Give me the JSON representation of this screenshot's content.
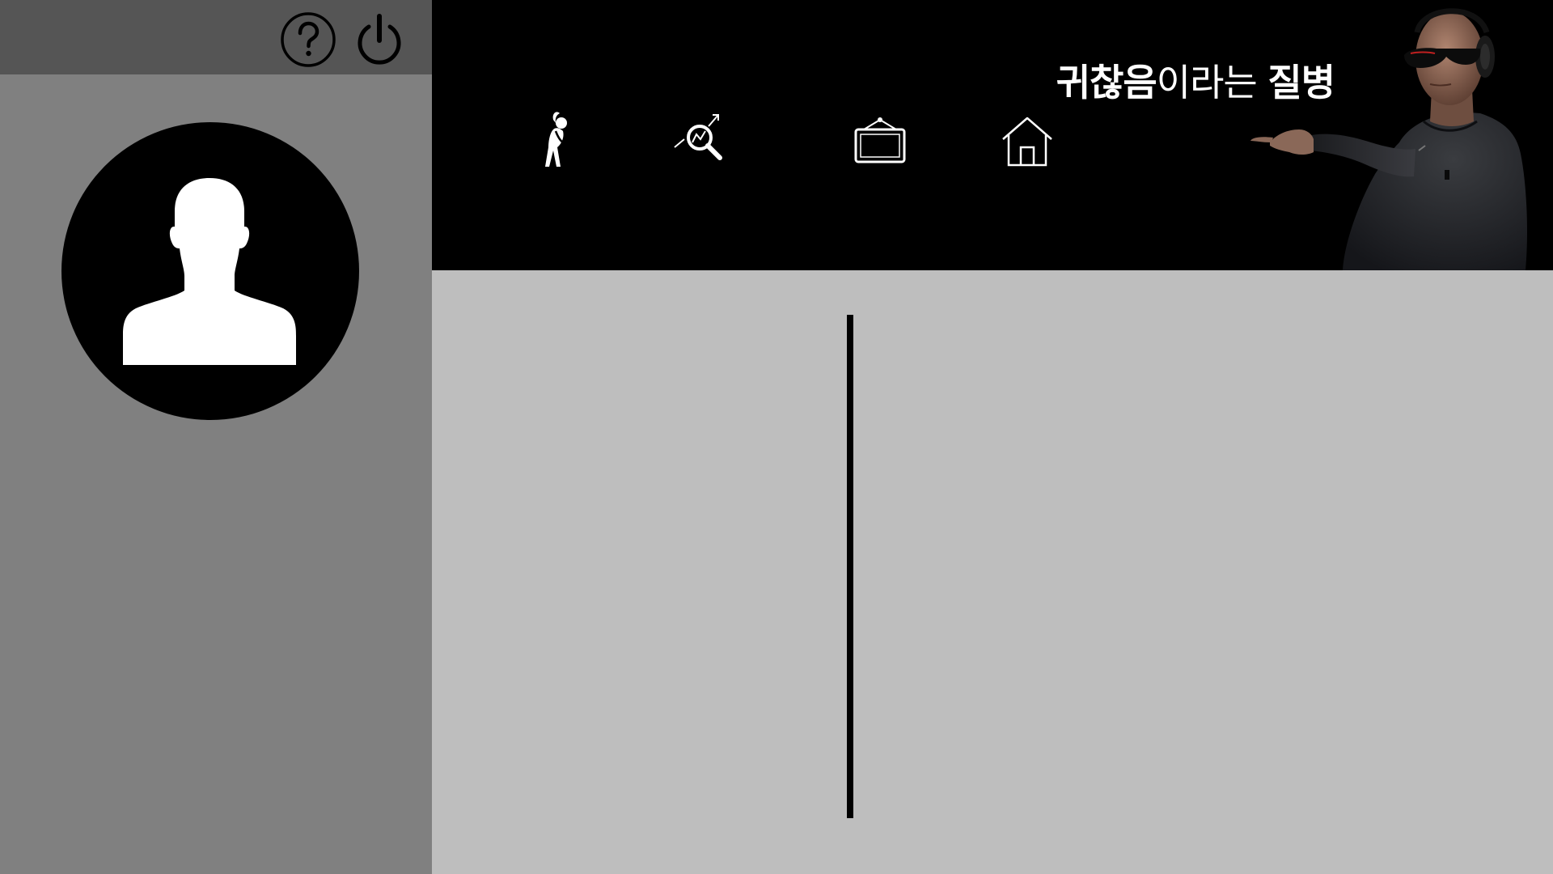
{
  "banner": {
    "word1": "귀찮음",
    "word2": "이라는",
    "word3": "질병"
  },
  "icons": {
    "help": "help-circle-icon",
    "power": "power-icon",
    "avatar": "user-silhouette-icon",
    "exercise": "stretching-person-icon",
    "analysis": "magnifier-chart-icon",
    "board": "hanging-board-icon",
    "home": "home-icon"
  },
  "colors": {
    "sidebar": "#808080",
    "sidebar_top": "#555555",
    "header": "#000000",
    "main": "#bebebe"
  }
}
